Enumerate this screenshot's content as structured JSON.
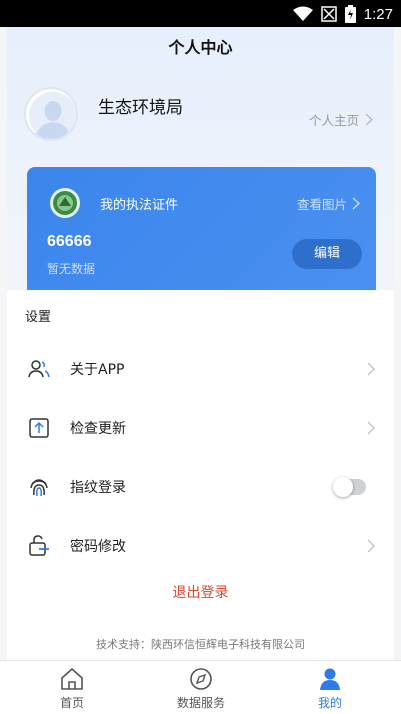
{
  "status_bar": {
    "time": "1:27"
  },
  "header": {
    "title": "个人中心"
  },
  "profile": {
    "name": "生态环境局",
    "home_link": "个人主页"
  },
  "certificate": {
    "title": "我的执法证件",
    "view_label": "查看图片",
    "number": "66666",
    "subtitle": "暂无数据",
    "edit_label": "编辑"
  },
  "settings": {
    "label": "设置",
    "items": [
      {
        "label": "关于APP",
        "icon": "users-icon"
      },
      {
        "label": "检查更新",
        "icon": "upload-icon"
      },
      {
        "label": "指纹登录",
        "icon": "fingerprint-icon"
      },
      {
        "label": "密码修改",
        "icon": "lock-edit-icon"
      }
    ],
    "logout_label": "退出登录",
    "support_text": "技术支持：陕西环信恒辉电子科技有限公司"
  },
  "bottom_nav": {
    "items": [
      {
        "label": "首页",
        "icon": "home-icon"
      },
      {
        "label": "数据服务",
        "icon": "compass-icon"
      },
      {
        "label": "我的",
        "icon": "person-icon"
      }
    ],
    "active_index": 2
  },
  "colors": {
    "accent": "#3b85ec",
    "logout": "#d9482f",
    "active_tab": "#2f7be5"
  }
}
